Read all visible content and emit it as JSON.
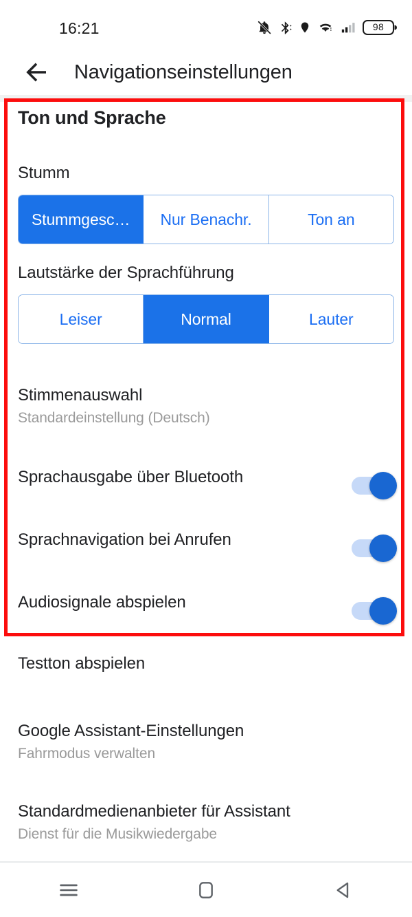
{
  "status_bar": {
    "time": "16:21",
    "battery_level": "98",
    "icons": [
      "bell-off-icon",
      "bluetooth-icon",
      "location-icon",
      "wifi-icon",
      "signal-icon",
      "battery-icon"
    ]
  },
  "title_bar": {
    "back_label": "back-arrow-icon",
    "title": "Navigationseinstellungen"
  },
  "content": {
    "section_title": "Ton und Sprache",
    "mute": {
      "label": "Stumm",
      "options": [
        "Stummgesc…",
        "Nur Benachr.",
        "Ton an"
      ],
      "selected_index": 0
    },
    "volume": {
      "label": "Lautstärke der Sprachführung",
      "options": [
        "Leiser",
        "Normal",
        "Lauter"
      ],
      "selected_index": 1
    },
    "voice_selection": {
      "title": "Stimmenauswahl",
      "subtitle": "Standardeinstellung (Deutsch)"
    },
    "toggles": [
      {
        "title": "Sprachausgabe über Bluetooth",
        "state": "on"
      },
      {
        "title": "Sprachnavigation bei Anrufen",
        "state": "on"
      },
      {
        "title": "Audiosignale abspielen",
        "state": "on"
      }
    ],
    "test_sound": {
      "title": "Testton abspielen"
    },
    "assistant_settings": {
      "title": "Google Assistant-Einstellungen",
      "subtitle": "Fahrmodus verwalten"
    },
    "media_provider": {
      "title": "Standardmedienanbieter für Assistant",
      "subtitle": "Dienst für die Musikwiedergabe"
    }
  },
  "annotation": {
    "highlight_color": "#fc0d0d"
  },
  "nav_bar": {
    "buttons": [
      "recent-apps-icon",
      "home-icon",
      "back-icon"
    ]
  },
  "colors": {
    "accent_blue": "#1b72e8",
    "toggle_track": "#c6d9f8",
    "toggle_thumb": "#1967d2",
    "text_primary": "#202124",
    "text_secondary": "#9a9a9a"
  }
}
